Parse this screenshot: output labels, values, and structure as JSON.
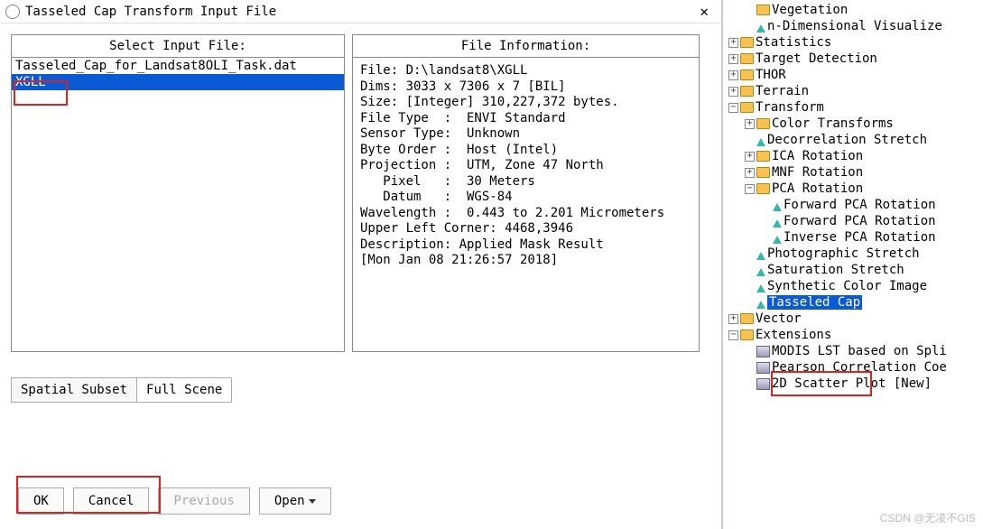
{
  "dialog": {
    "title": "Tasseled Cap Transform Input File",
    "close": "✕",
    "select_header": "Select Input File:",
    "info_header": "File Information:",
    "files": [
      "Tasseled_Cap_for_Landsat8OLI_Task.dat",
      "XGLL"
    ],
    "file_info": "File: D:\\landsat8\\XGLL\nDims: 3033 x 7306 x 7 [BIL]\nSize: [Integer] 310,227,372 bytes.\nFile Type  :  ENVI Standard\nSensor Type:  Unknown\nByte Order :  Host (Intel)\nProjection :  UTM, Zone 47 North\n   Pixel   :  30 Meters\n   Datum   :  WGS-84\nWavelength :  0.443 to 2.201 Micrometers\nUpper Left Corner: 4468,3946\nDescription: Applied Mask Result\n[Mon Jan 08 21:26:57 2018]",
    "subset_label": "Spatial Subset",
    "subset_value": "Full Scene",
    "buttons": {
      "ok": "OK",
      "cancel": "Cancel",
      "previous": "Previous",
      "open": "Open"
    }
  },
  "tree": {
    "items": [
      {
        "ind": 1,
        "exp": "",
        "ico": "folder",
        "label": "Vegetation"
      },
      {
        "ind": 1,
        "exp": "",
        "ico": "flask",
        "label": "n-Dimensional Visualize"
      },
      {
        "ind": 0,
        "exp": "+",
        "ico": "folder",
        "label": "Statistics"
      },
      {
        "ind": 0,
        "exp": "+",
        "ico": "folder",
        "label": "Target Detection"
      },
      {
        "ind": 0,
        "exp": "+",
        "ico": "folder",
        "label": "THOR"
      },
      {
        "ind": 0,
        "exp": "+",
        "ico": "folder",
        "label": "Terrain"
      },
      {
        "ind": 0,
        "exp": "−",
        "ico": "folder",
        "label": "Transform"
      },
      {
        "ind": 1,
        "exp": "+",
        "ico": "folder",
        "label": "Color Transforms"
      },
      {
        "ind": 1,
        "exp": "",
        "ico": "flask",
        "label": "Decorrelation Stretch"
      },
      {
        "ind": 1,
        "exp": "+",
        "ico": "folder",
        "label": "ICA Rotation"
      },
      {
        "ind": 1,
        "exp": "+",
        "ico": "folder",
        "label": "MNF Rotation"
      },
      {
        "ind": 1,
        "exp": "−",
        "ico": "folder",
        "label": "PCA Rotation"
      },
      {
        "ind": 2,
        "exp": "",
        "ico": "flask",
        "label": "Forward PCA Rotation"
      },
      {
        "ind": 2,
        "exp": "",
        "ico": "flask",
        "label": "Forward PCA Rotation"
      },
      {
        "ind": 2,
        "exp": "",
        "ico": "flask",
        "label": "Inverse PCA Rotation"
      },
      {
        "ind": 1,
        "exp": "",
        "ico": "flask",
        "label": "Photographic Stretch"
      },
      {
        "ind": 1,
        "exp": "",
        "ico": "flask",
        "label": "Saturation Stretch"
      },
      {
        "ind": 1,
        "exp": "",
        "ico": "flask",
        "label": "Synthetic Color Image"
      },
      {
        "ind": 1,
        "exp": "",
        "ico": "flask",
        "label": "Tasseled Cap",
        "selected": true
      },
      {
        "ind": 0,
        "exp": "+",
        "ico": "folder",
        "label": "Vector"
      },
      {
        "ind": 0,
        "exp": "−",
        "ico": "folder",
        "label": "Extensions"
      },
      {
        "ind": 1,
        "exp": "",
        "ico": "tool",
        "label": "MODIS LST based on Spli"
      },
      {
        "ind": 1,
        "exp": "",
        "ico": "tool",
        "label": "Pearson Correlation Coe"
      },
      {
        "ind": 1,
        "exp": "",
        "ico": "tool",
        "label": "2D Scatter Plot [New]"
      }
    ]
  },
  "watermark": "CSDN @无凌不GIS"
}
